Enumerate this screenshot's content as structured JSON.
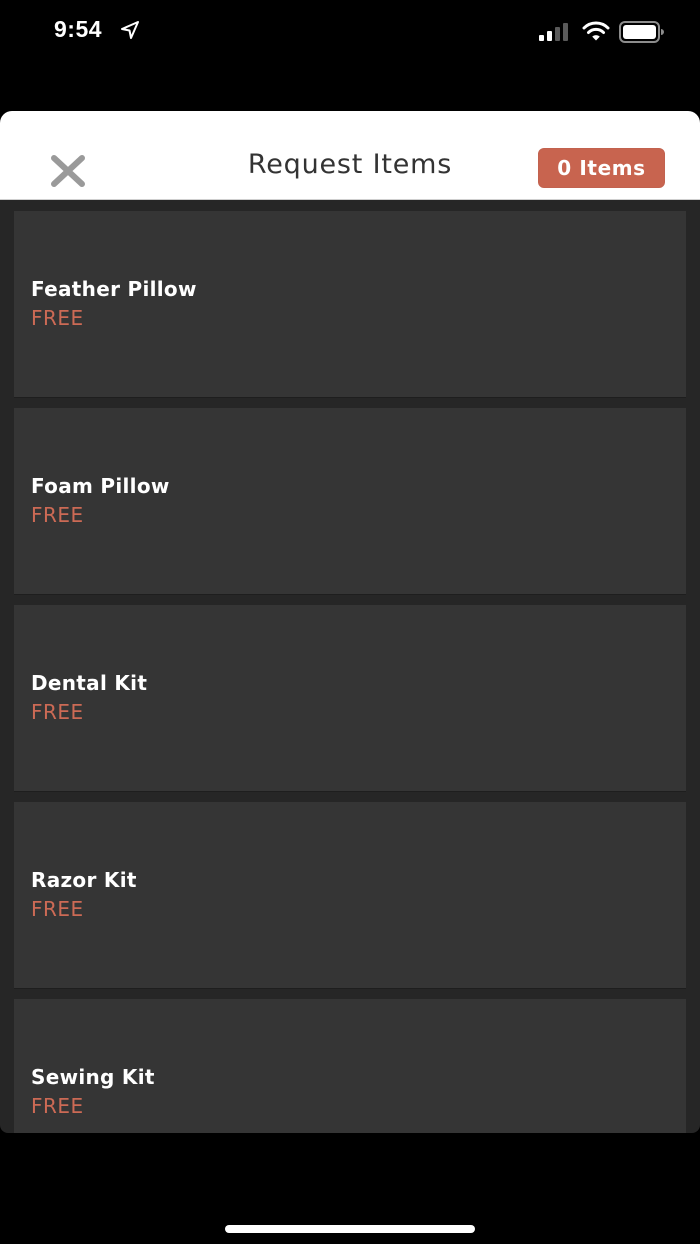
{
  "status_bar": {
    "time": "9:54",
    "location_icon": "location-arrow-icon",
    "signal_icon": "cellular-signal-icon",
    "wifi_icon": "wifi-icon",
    "battery_icon": "battery-icon"
  },
  "header": {
    "close_icon": "close-icon",
    "title": "Request Items",
    "items_badge": "0 Items"
  },
  "items": [
    {
      "name": "Feather Pillow",
      "price": "FREE"
    },
    {
      "name": "Foam Pillow",
      "price": "FREE"
    },
    {
      "name": "Dental Kit",
      "price": "FREE"
    },
    {
      "name": "Razor Kit",
      "price": "FREE"
    },
    {
      "name": "Sewing Kit",
      "price": "FREE"
    }
  ],
  "colors": {
    "accent": "#c8644f",
    "price": "#cc6a55",
    "card_bg": "#353535",
    "sheet_bg": "#262626",
    "header_bg": "#ffffff"
  }
}
